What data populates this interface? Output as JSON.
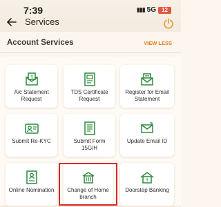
{
  "status_bar": {
    "time": "7:39",
    "signal_label": "5G",
    "battery_label": "12"
  },
  "header": {
    "title": "Services",
    "back_icon": "arrow-left-icon",
    "power_icon": "power-icon"
  },
  "section": {
    "title": "Account Services",
    "toggle_label": "VIEW LESS"
  },
  "tiles": [
    {
      "label": "A/c Statement Request",
      "icon": "statement-envelope-icon"
    },
    {
      "label": "TDS Certificate Request",
      "icon": "certificate-doc-icon"
    },
    {
      "label": "Register for Email Statement",
      "icon": "email-register-icon"
    },
    {
      "label": "Submit Re-KYC",
      "icon": "id-card-icon"
    },
    {
      "label": "Submit Form 15G/H",
      "icon": "form-doc-icon"
    },
    {
      "label": "Update Email ID",
      "icon": "email-update-icon"
    },
    {
      "label": "Online Nomination",
      "icon": "nomination-doc-icon"
    },
    {
      "label": "Change of Home branch",
      "icon": "branch-change-icon"
    },
    {
      "label": "Doorstep Banking",
      "icon": "home-bank-icon"
    }
  ],
  "colors": {
    "accent": "#e07a1f",
    "icon_green": "#2d8a3c",
    "highlight": "#d8282b",
    "battery": "#e5553d"
  }
}
